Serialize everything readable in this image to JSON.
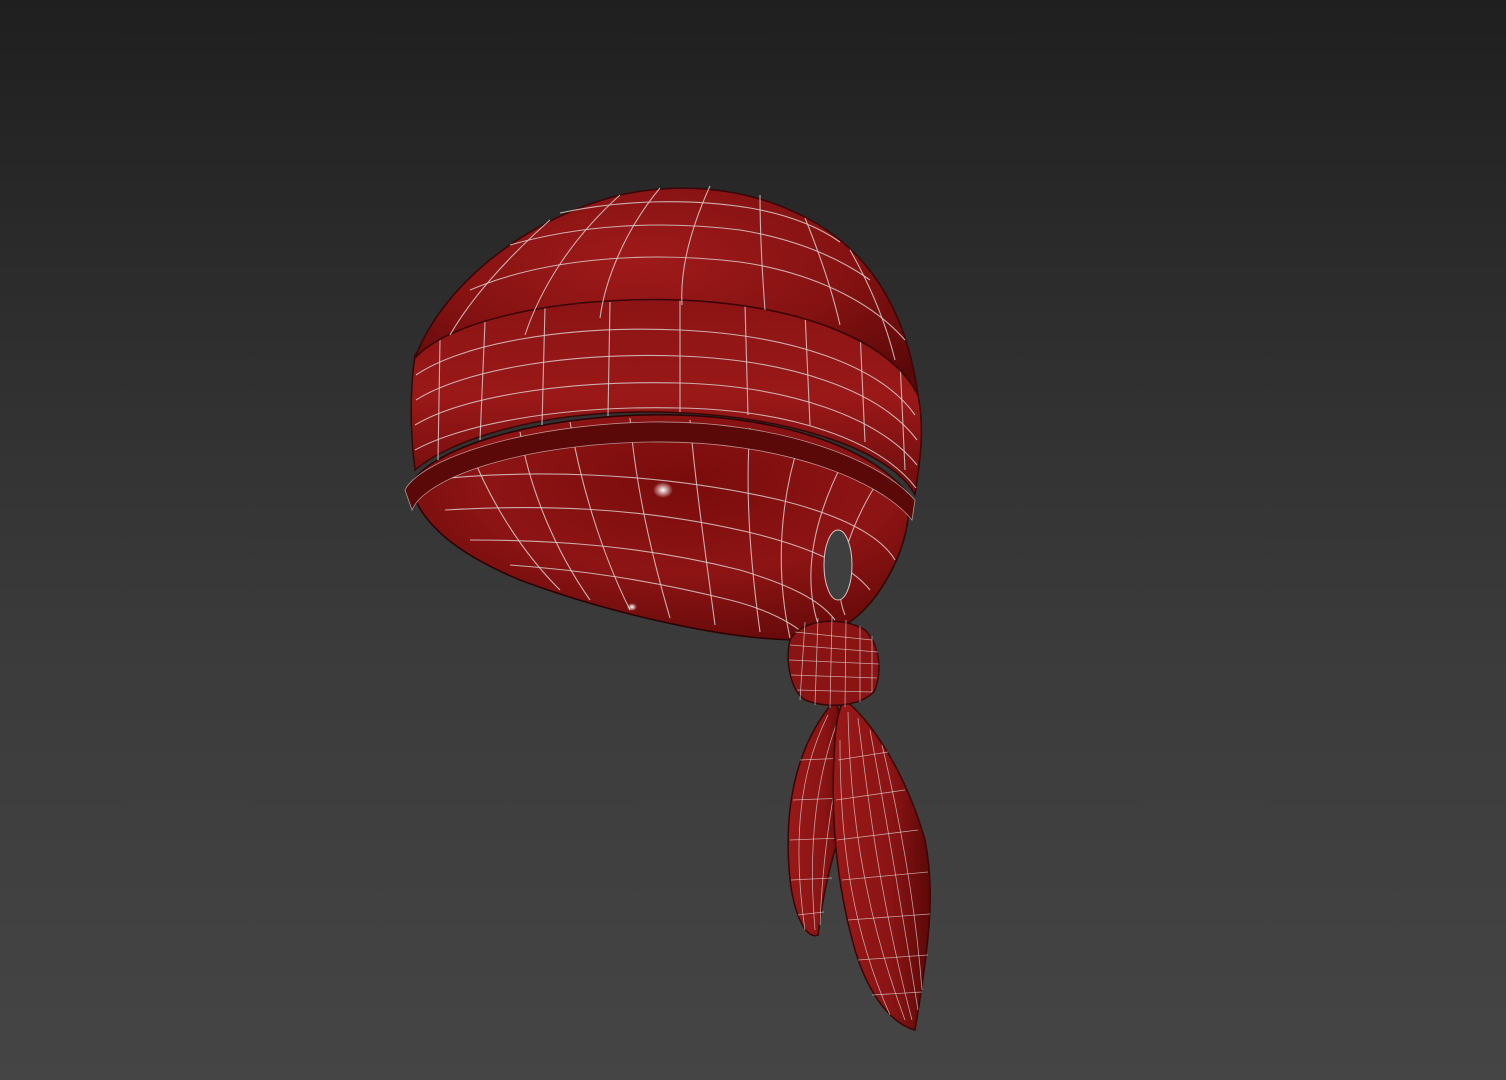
{
  "viewport": {
    "background_top": "#1f1f1f",
    "background_bottom": "#454545",
    "shading_mode": "shaded-with-wireframe"
  },
  "model": {
    "object": "bandana",
    "material_color": "#8a1414",
    "material_dark": "#4a0606",
    "wire_color": "#d9c9c9",
    "parts": [
      "crown",
      "folded-band",
      "inner-lining",
      "knot",
      "tail-left",
      "tail-right"
    ]
  }
}
